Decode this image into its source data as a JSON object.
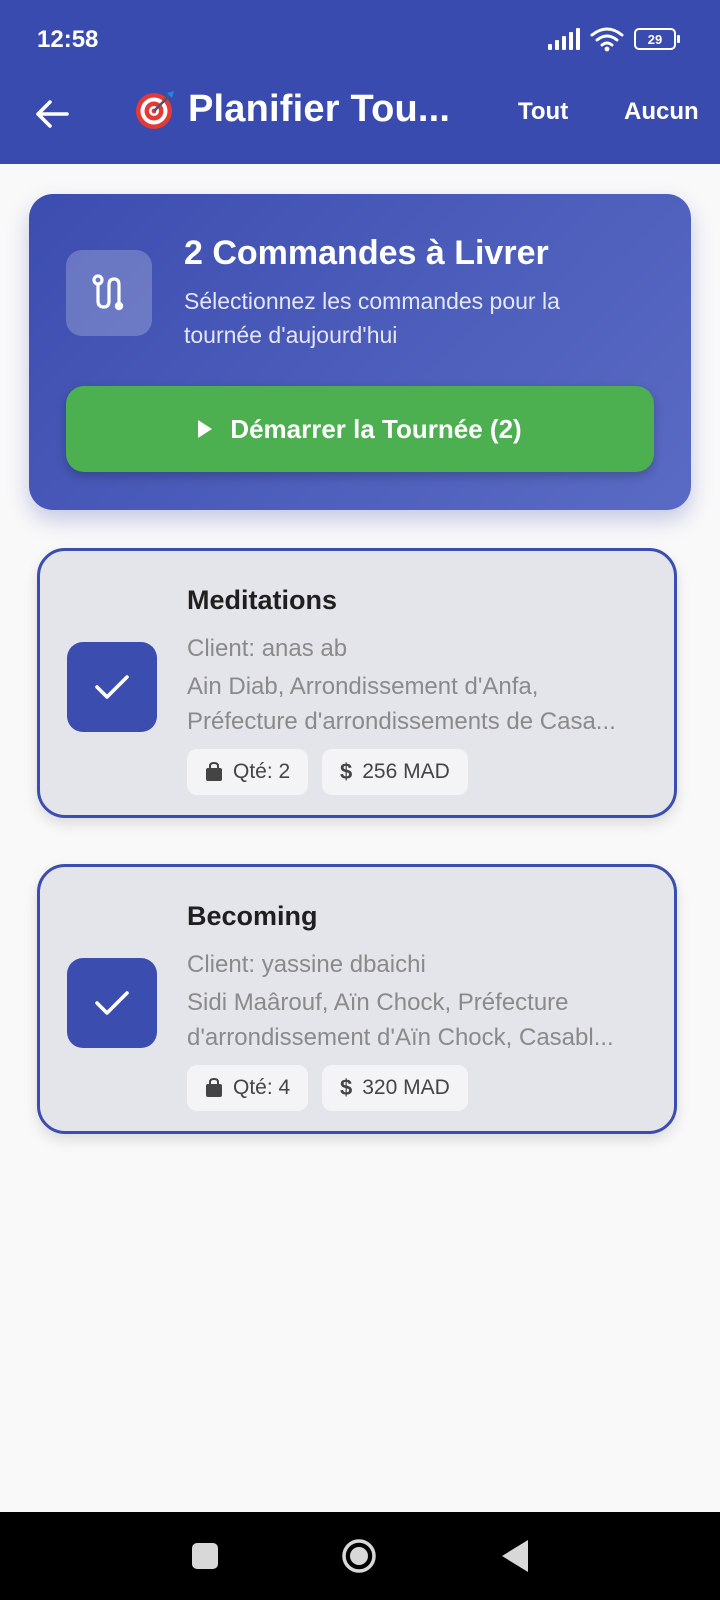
{
  "status_bar": {
    "time": "12:58",
    "battery": "29"
  },
  "app_bar": {
    "title": "Planifier Tou...",
    "action_all": "Tout",
    "action_none": "Aucun"
  },
  "header": {
    "title": "2 Commandes à Livrer",
    "subtitle_line1": "Sélectionnez les commandes pour la",
    "subtitle_line2": "tournée d'aujourd'hui",
    "start_button": "Démarrer la Tournée (2)"
  },
  "orders": [
    {
      "title": "Meditations",
      "client": "Client: anas ab",
      "address_line1": "Ain Diab, Arrondissement d'Anfa,",
      "address_line2": "Préfecture d'arrondissements de Casa...",
      "qty": "Qté: 2",
      "price": "256 MAD",
      "selected": true
    },
    {
      "title": "Becoming",
      "client": "Client: yassine dbaichi",
      "address_line1": "Sidi Maârouf, Aïn Chock, Préfecture",
      "address_line2": "d'arrondissement d'Aïn Chock, Casabl...",
      "qty": "Qté: 4",
      "price": "320 MAD",
      "selected": true
    }
  ],
  "colors": {
    "primary": "#3a4baf",
    "success": "#4caf50",
    "card_bg": "#e4e5ea"
  },
  "icons": [
    "back-arrow-icon",
    "target-icon",
    "route-icon",
    "play-icon",
    "check-icon",
    "shopping-bag-icon",
    "dollar-icon",
    "signal-icon",
    "wifi-icon",
    "battery-icon"
  ]
}
